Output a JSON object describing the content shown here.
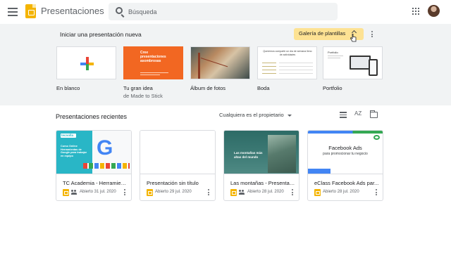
{
  "topbar": {
    "app_title": "Presentaciones",
    "search_placeholder": "Búsqueda"
  },
  "templates": {
    "heading": "Iniciar una presentación nueva",
    "gallery_label": "Galería de plantillas",
    "items": [
      {
        "name": "En blanco",
        "sub": ""
      },
      {
        "name": "Tu gran idea",
        "sub": "de Made to Stick",
        "thumb_text": "Cree presentaciones asombrosas"
      },
      {
        "name": "Álbum de fotos",
        "sub": ""
      },
      {
        "name": "Boda",
        "sub": "",
        "thumb_text": "Queremos compartir un día de semana lleno de actividades"
      },
      {
        "name": "Portfolio",
        "sub": "",
        "thumb_text": "Portfolio"
      }
    ]
  },
  "recent": {
    "heading": "Presentaciones recientes",
    "owner_filter": "Cualquiera es el propietario",
    "sort_label": "AZ",
    "cards": [
      {
        "title": "TC Academia - Herramien...",
        "date": "Abierto 31 jul. 2020",
        "thumb_logo": "tecnolla",
        "thumb_text": "Curso Online Herramientas de Google para trabajar en equipo",
        "thumb_glyph": "G"
      },
      {
        "title": "Presentación sin título",
        "date": "Abierto 29 jul. 2020"
      },
      {
        "title": "Las montañas - Presentac...",
        "date": "Abierto 28 jul. 2020",
        "thumb_text": "Las montañas más altas del mundo"
      },
      {
        "title": "eClass Facebook Ads par...",
        "date": "Abierto 28 jul. 2020",
        "thumb_title": "Facebook Ads",
        "thumb_sub": "para promocionar tu negocio"
      }
    ]
  },
  "colors": {
    "brand_yellow": "#f4b400",
    "gallery_highlight": "#fde293",
    "section_bg": "#f1f3f4",
    "idea_orange": "#f26722"
  },
  "icons": [
    "menu-icon",
    "slides-logo-icon",
    "search-icon",
    "apps-grid-icon",
    "avatar",
    "plus-icon",
    "chevron-up-icon",
    "more-vert-icon",
    "list-view-icon",
    "sort-az-icon",
    "folder-icon",
    "people-icon"
  ]
}
